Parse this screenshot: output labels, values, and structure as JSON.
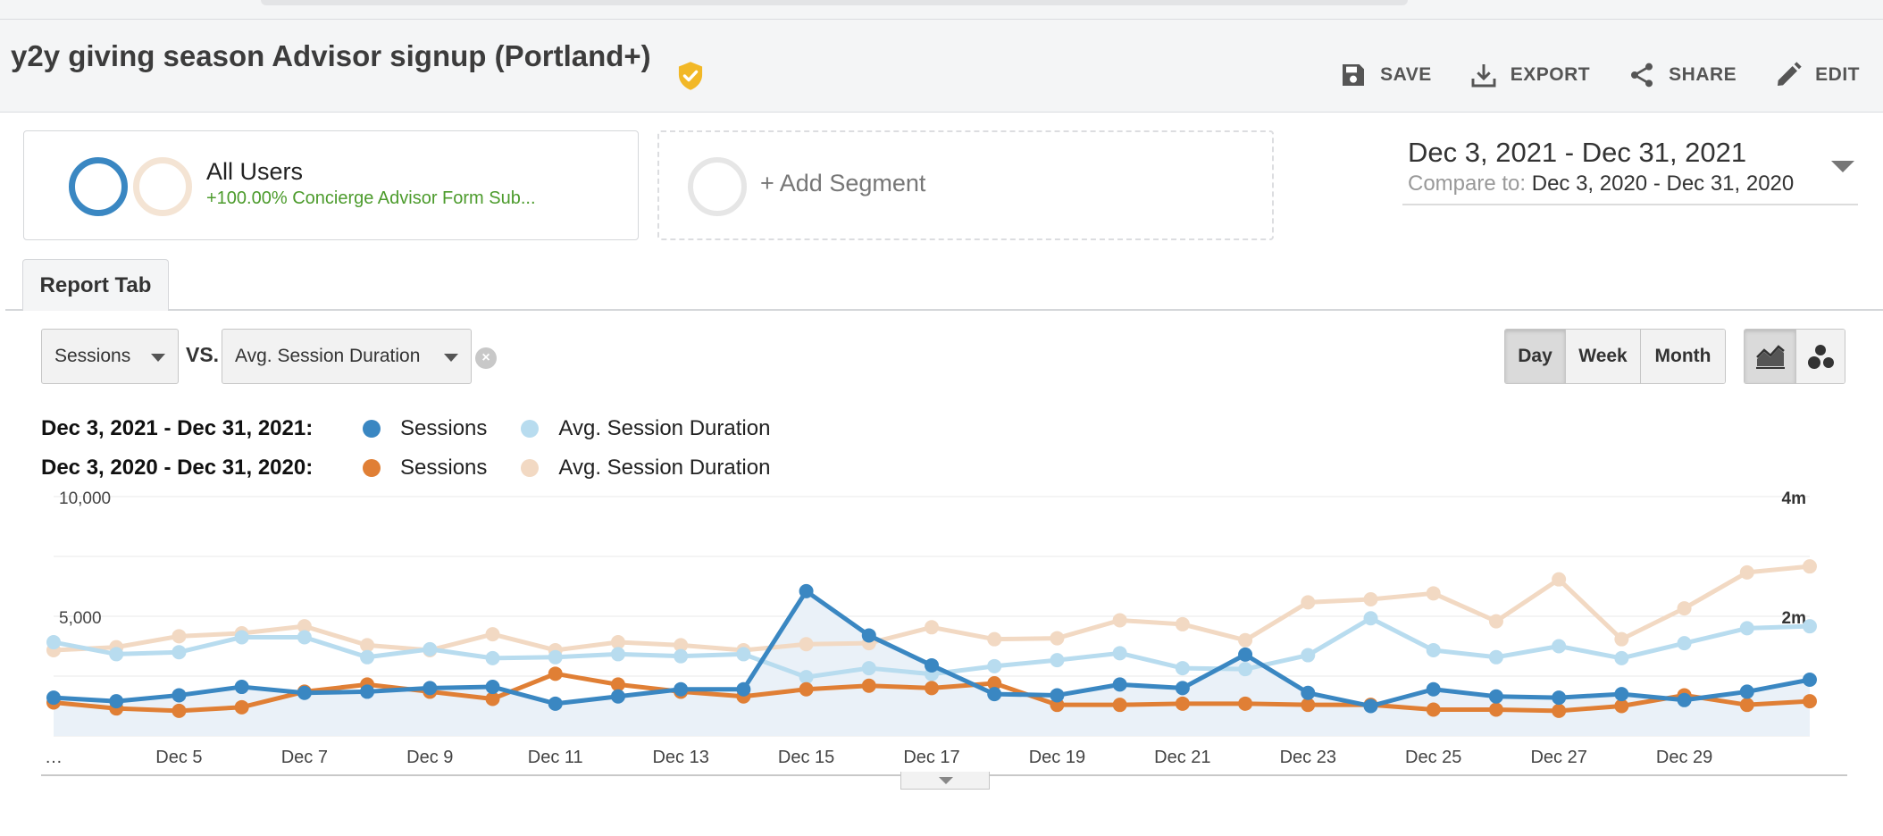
{
  "report": {
    "title": "y2y giving season Advisor signup (Portland+)",
    "actions": [
      {
        "label": "SAVE",
        "icon": "save-icon"
      },
      {
        "label": "EXPORT",
        "icon": "download-icon"
      },
      {
        "label": "SHARE",
        "icon": "share-icon"
      },
      {
        "label": "EDIT",
        "icon": "pencil-icon"
      }
    ]
  },
  "segments": {
    "active": {
      "name": "All Users",
      "detail": "+100.00% Concierge Advisor Form Sub..."
    },
    "add_label": "+ Add Segment"
  },
  "date_range": {
    "current": "Dec 3, 2021 - Dec 31, 2021",
    "compare_label": "Compare to:",
    "compare": "Dec 3, 2020 - Dec 31, 2020"
  },
  "tabs": {
    "report_tab": "Report Tab"
  },
  "controls": {
    "metric_primary": "Sessions",
    "vs_label": "VS.",
    "metric_secondary": "Avg. Session Duration",
    "granularity": [
      "Day",
      "Week",
      "Month"
    ],
    "granularity_selected": "Day",
    "chart_mode_icons": [
      "line-chart-icon",
      "motion-chart-icon"
    ]
  },
  "legend": {
    "rows": [
      {
        "period": "Dec 3, 2021 - Dec 31, 2021:",
        "sessions": "Sessions",
        "duration": "Avg. Session Duration"
      },
      {
        "period": "Dec 3, 2020 - Dec 31, 2020:",
        "sessions": "Sessions",
        "duration": "Avg. Session Duration"
      }
    ]
  },
  "colors": {
    "sessions_current": "#3a87c2",
    "duration_current": "#b8dcef",
    "sessions_previous": "#e07f35",
    "duration_previous": "#f2d9c3",
    "area_fill": "#eaf1f8"
  },
  "chart_data": {
    "type": "line",
    "x": [
      "Dec 3",
      "Dec 4",
      "Dec 5",
      "Dec 6",
      "Dec 7",
      "Dec 8",
      "Dec 9",
      "Dec 10",
      "Dec 11",
      "Dec 12",
      "Dec 13",
      "Dec 14",
      "Dec 15",
      "Dec 16",
      "Dec 17",
      "Dec 18",
      "Dec 19",
      "Dec 20",
      "Dec 21",
      "Dec 22",
      "Dec 23",
      "Dec 24",
      "Dec 25",
      "Dec 26",
      "Dec 27",
      "Dec 28",
      "Dec 29",
      "Dec 30",
      "Dec 31"
    ],
    "x_tick_labels": [
      "…",
      "Dec 5",
      "Dec 7",
      "Dec 9",
      "Dec 11",
      "Dec 13",
      "Dec 15",
      "Dec 17",
      "Dec 19",
      "Dec 21",
      "Dec 23",
      "Dec 25",
      "Dec 27",
      "Dec 29"
    ],
    "y_left": {
      "ticks": [
        "10,000",
        "5,000"
      ],
      "range": [
        0,
        10000
      ]
    },
    "y_right": {
      "ticks": [
        "4m",
        "2m"
      ],
      "range_seconds": [
        0,
        240
      ]
    },
    "grid": true,
    "legend_position": "top-left",
    "series": [
      {
        "name": "Sessions",
        "period": "Dec 3, 2021 - Dec 31, 2021",
        "axis": "left",
        "area": true,
        "values": [
          1600,
          1450,
          1700,
          2050,
          1800,
          1850,
          2000,
          2050,
          1350,
          1650,
          1950,
          1950,
          6050,
          4200,
          2950,
          1750,
          1700,
          2150,
          2000,
          3400,
          1800,
          1250,
          1950,
          1650,
          1600,
          1750,
          1500,
          1850,
          2350
        ]
      },
      {
        "name": "Avg. Session Duration",
        "period": "Dec 3, 2021 - Dec 31, 2021",
        "axis": "right",
        "values": [
          94,
          82,
          84,
          99,
          99,
          79,
          87,
          78,
          79,
          82,
          80,
          82,
          59,
          68,
          62,
          70,
          76,
          83,
          68,
          67,
          81,
          118,
          86,
          79,
          90,
          78,
          93,
          108,
          110
        ]
      },
      {
        "name": "Sessions",
        "period": "Dec 3, 2020 - Dec 31, 2020",
        "axis": "left",
        "values": [
          1400,
          1150,
          1050,
          1200,
          1850,
          2150,
          1850,
          1550,
          2600,
          2150,
          1850,
          1650,
          1950,
          2100,
          2000,
          2200,
          1300,
          1300,
          1350,
          1350,
          1300,
          1300,
          1100,
          1100,
          1050,
          1250,
          1700,
          1300,
          1450
        ]
      },
      {
        "name": "Avg. Session Duration",
        "period": "Dec 3, 2020 - Dec 31, 2020",
        "axis": "right",
        "values": [
          86,
          89,
          100,
          103,
          110,
          91,
          86,
          102,
          86,
          94,
          91,
          86,
          92,
          93,
          109,
          97,
          98,
          116,
          112,
          96,
          134,
          137,
          143,
          115,
          157,
          97,
          128,
          164,
          170
        ]
      }
    ]
  }
}
